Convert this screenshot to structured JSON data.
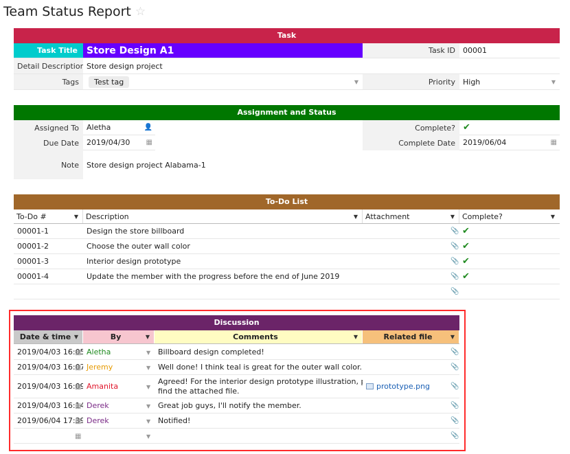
{
  "page": {
    "title": "Team Status Report"
  },
  "task": {
    "header": "Task",
    "title_label": "Task Title",
    "title_value": "Store Design A1",
    "id_label": "Task ID",
    "id_value": "00001",
    "desc_label": "Detail Description",
    "desc_value": "Store design project",
    "tags_label": "Tags",
    "tag": "Test tag",
    "priority_label": "Priority",
    "priority_value": "High",
    "colors": {
      "header": "#c8234a",
      "title_label_bg": "#00cccc",
      "title_value_bg": "#6600ff"
    }
  },
  "assignment": {
    "header": "Assignment and Status",
    "assigned_label": "Assigned To",
    "assigned_value": "Aletha",
    "complete_label": "Complete?",
    "due_label": "Due Date",
    "due_value": "2019/04/30",
    "complete_date_label": "Complete Date",
    "complete_date_value": "2019/06/04",
    "note_label": "Note",
    "note_value": "Store design project Alabama-1",
    "colors": {
      "header": "#007700"
    }
  },
  "todo": {
    "header": "To-Do List",
    "columns": [
      "To-Do #",
      "Description",
      "Attachment",
      "Complete?"
    ],
    "rows": [
      {
        "num": "00001-1",
        "desc": "Design the store billboard"
      },
      {
        "num": "00001-2",
        "desc": "Choose the outer wall color"
      },
      {
        "num": "00001-3",
        "desc": "Interior design prototype"
      },
      {
        "num": "00001-4",
        "desc": "Update the member with the progress before the end of June 2019"
      }
    ],
    "colors": {
      "header": "#a0672a"
    }
  },
  "discussion": {
    "header": "Discussion",
    "columns": [
      "Date & time",
      "By",
      "Comments",
      "Related file"
    ],
    "rows": [
      {
        "date": "2019/04/03 16:05",
        "by": "Aletha",
        "comment": "Billboard design completed!",
        "file": ""
      },
      {
        "date": "2019/04/03 16:07",
        "by": "Jeremy",
        "comment": "Well done! I think teal is great for the outer wall color.",
        "file": ""
      },
      {
        "date": "2019/04/03 16:09",
        "by": "Amanita",
        "comment": "Agreed! For the interior design prototype illustration, please",
        "comment2": "find the attached file.",
        "file": "prototype.png"
      },
      {
        "date": "2019/04/03 16:14",
        "by": "Derek",
        "comment": "Great job guys, I'll notify the member.",
        "file": ""
      },
      {
        "date": "2019/06/04 17:39",
        "by": "Derek",
        "comment": "Notified!",
        "file": ""
      }
    ],
    "colors": {
      "header": "#6b2468",
      "date_hdr": "#c9c9c9",
      "by_hdr": "#f7c6cf",
      "comment_hdr": "#fffcc2",
      "file_hdr": "#f6c07b",
      "aletha": "#1f8a1f",
      "jeremy": "#e69a00",
      "amanita": "#e0142a",
      "derek": "#7a2a86"
    }
  }
}
